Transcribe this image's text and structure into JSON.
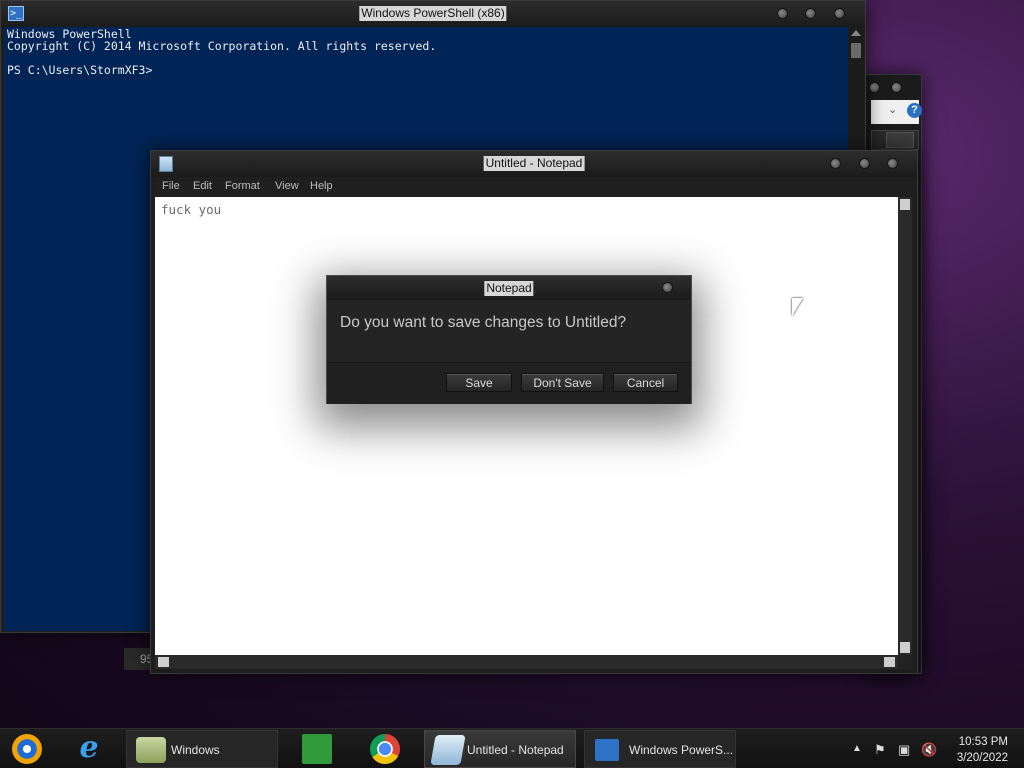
{
  "powershell": {
    "title": "Windows PowerShell (x86)",
    "lines": [
      "Windows PowerShell",
      "Copyright (C) 2014 Microsoft Corporation. All rights reserved.",
      "",
      "PS C:\\Users\\StormXF3>"
    ]
  },
  "background_window": {
    "status_text": "95"
  },
  "notepad": {
    "title": "Untitled - Notepad",
    "menu": [
      "File",
      "Edit",
      "Format",
      "View",
      "Help"
    ],
    "content": "fuck you"
  },
  "dialog": {
    "title": "Notepad",
    "message": "Do you want to save changes to Untitled?",
    "buttons": {
      "save": "Save",
      "dont_save": "Don't Save",
      "cancel": "Cancel"
    }
  },
  "taskbar": {
    "items": [
      {
        "name": "media-player",
        "icon": "media-player-icon",
        "label": ""
      },
      {
        "name": "internet-explorer",
        "icon": "internet-explorer-icon",
        "label": ""
      },
      {
        "name": "file-explorer",
        "icon": "folder-icon",
        "label": "Windows"
      },
      {
        "name": "store",
        "icon": "store-icon",
        "label": ""
      },
      {
        "name": "chrome",
        "icon": "chrome-icon",
        "label": ""
      },
      {
        "name": "notepad",
        "icon": "notepad-icon",
        "label": "Untitled - Notepad"
      },
      {
        "name": "powershell",
        "icon": "powershell-icon",
        "label": "Windows PowerS..."
      }
    ],
    "tray": {
      "icons": [
        "show-hidden-icons-icon",
        "action-center-flag-icon",
        "network-icon",
        "volume-muted-icon"
      ],
      "time": "10:53 PM",
      "date": "3/20/2022"
    }
  },
  "colors": {
    "console_bg": "#012456",
    "taskbar_bg": "#161616",
    "desktop_accent": "#5a2a6e"
  }
}
